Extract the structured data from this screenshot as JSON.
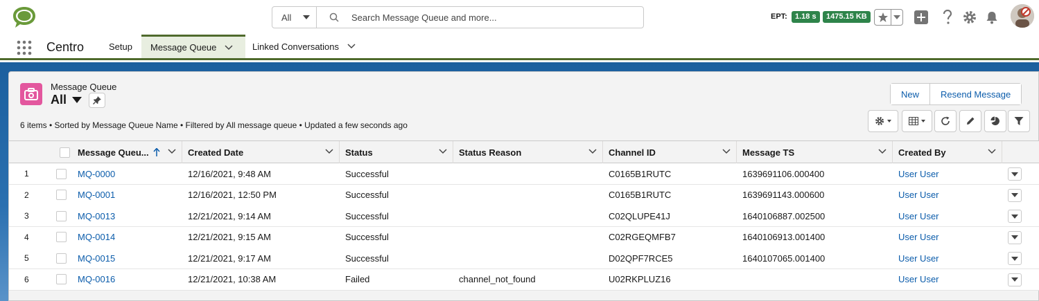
{
  "header": {
    "search_scope": "All",
    "search_placeholder": "Search Message Queue and more...",
    "ept_label": "EPT:",
    "ept_time": "1.18 s",
    "ept_size": "1475.15 KB"
  },
  "nav": {
    "app_name": "Centro",
    "tabs": [
      {
        "label": "Setup"
      },
      {
        "label": "Message Queue"
      },
      {
        "label": "Linked Conversations"
      }
    ]
  },
  "list": {
    "object_label": "Message Queue",
    "view_name": "All",
    "meta": "6 items • Sorted by Message Queue Name • Filtered by All message queue • Updated a few seconds ago",
    "buttons": {
      "new": "New",
      "resend": "Resend Message"
    },
    "columns": [
      "Message Queu...",
      "Created Date",
      "Status",
      "Status Reason",
      "Channel ID",
      "Message TS",
      "Created By"
    ],
    "rows": [
      {
        "num": "1",
        "name": "MQ-0000",
        "created": "12/16/2021, 9:48 AM",
        "status": "Successful",
        "reason": "",
        "channel": "C0165B1RUTC",
        "ts": "1639691106.000400",
        "by": "User User"
      },
      {
        "num": "2",
        "name": "MQ-0001",
        "created": "12/16/2021, 12:50 PM",
        "status": "Successful",
        "reason": "",
        "channel": "C0165B1RUTC",
        "ts": "1639691143.000600",
        "by": "User User"
      },
      {
        "num": "3",
        "name": "MQ-0013",
        "created": "12/21/2021, 9:14 AM",
        "status": "Successful",
        "reason": "",
        "channel": "C02QLUPE41J",
        "ts": "1640106887.002500",
        "by": "User User"
      },
      {
        "num": "4",
        "name": "MQ-0014",
        "created": "12/21/2021, 9:15 AM",
        "status": "Successful",
        "reason": "",
        "channel": "C02RGEQMFB7",
        "ts": "1640106913.001400",
        "by": "User User"
      },
      {
        "num": "5",
        "name": "MQ-0015",
        "created": "12/21/2021, 9:17 AM",
        "status": "Successful",
        "reason": "",
        "channel": "D02QPF7RCE5",
        "ts": "1640107065.001400",
        "by": "User User"
      },
      {
        "num": "6",
        "name": "MQ-0016",
        "created": "12/21/2021, 10:38 AM",
        "status": "Failed",
        "reason": "channel_not_found",
        "channel": "U02RKPLUZ16",
        "ts": "",
        "by": "User User"
      }
    ]
  },
  "colors": {
    "brand_green": "#4f6a2c",
    "link": "#0b5cab",
    "badge_green": "#2e844a",
    "object_icon": "#e3579e"
  }
}
